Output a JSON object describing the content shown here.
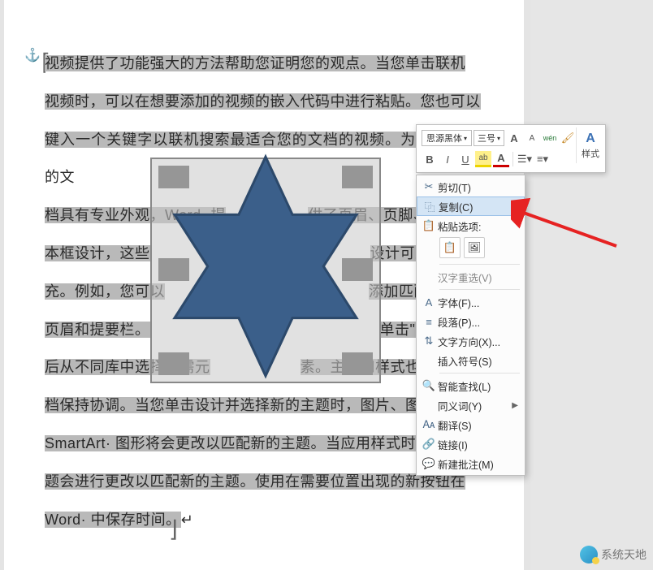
{
  "anchor_glyph": "⚓",
  "document": {
    "text_lines": [
      "视频提供了功能强大的方法帮助您证明您的观点。当您单击联机",
      "视频时，可以在想要添加的视频的嵌入代码中进行粘贴。您也可以",
      "键入一个关键字以联机搜索最适合您的文档的视频。为使您的文",
      "档具有专业外观，Word· 提",
      "供了页眉、页脚、封面和文",
      "本框设计，这些",
      "设计可互为补",
      "充。例如，您可以",
      "添加匹配的封面、",
      "页眉和提要栏。",
      "单击\"插入\"，然",
      "后从不同库中选择所需元",
      "素。主题和样式也有助于文",
      "档保持协调。当您单击设计并选择新的主题时，图片、图表或",
      "SmartArt· 图形将会更改以匹配新的主题。当应用样式时，您的标",
      "题会进行更改以匹配新的主题。使用在需要位置出现的新按钮在",
      "Word· 中保存时间。"
    ]
  },
  "mini_toolbar": {
    "font_name": "思源黑体",
    "font_size": "三号",
    "grow": "A",
    "shrink": "A",
    "phonetic": "wén",
    "format_painter": "✎",
    "styles_label": "样式",
    "bold": "B",
    "italic": "I",
    "underline": "U",
    "highlight": "ab",
    "font_color": "A"
  },
  "context_menu": {
    "cut": "剪切(T)",
    "copy": "复制(C)",
    "paste_header": "粘贴选项:",
    "ime_reconvert": "汉字重选(V)",
    "font": "字体(F)...",
    "paragraph": "段落(P)...",
    "text_direction": "文字方向(X)...",
    "insert_symbol": "插入符号(S)",
    "smart_lookup": "智能查找(L)",
    "synonyms": "同义词(Y)",
    "translate": "翻译(S)",
    "link": "链接(I)",
    "new_comment": "新建批注(M)"
  },
  "watermark_text": "系统天地"
}
